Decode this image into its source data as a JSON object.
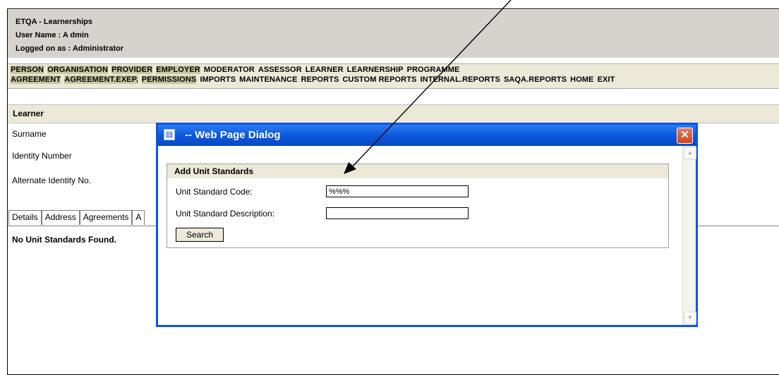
{
  "header": {
    "app_title": "ETQA - Learnerships",
    "user_name": "User Name : A dmin",
    "logged_on": "Logged on as : Administrator"
  },
  "menu": {
    "row1": [
      "PERSON",
      "ORGANISATION",
      "PROVIDER",
      "EMPLOYER",
      "MODERATOR",
      "ASSESSOR",
      "LEARNER",
      "LEARNERSHIP",
      "PROGRAMME"
    ],
    "row2": [
      "AGREEMENT",
      "AGREEMENT.EXEP.",
      "PERMISSIONS",
      "IMPORTS",
      "MAINTENANCE",
      "REPORTS",
      "CUSTOM REPORTS",
      "INTERNAL.REPORTS",
      "SAQA.REPORTS",
      "HOME",
      "EXIT"
    ]
  },
  "learner": {
    "section_title": "Learner",
    "surname_label": "Surname",
    "identity_label": "Identity Number",
    "alt_identity_label": "Alternate Identity No."
  },
  "tabs": [
    "Details",
    "Address",
    "Agreements",
    "A"
  ],
  "results": {
    "message": "No Unit Standards Found."
  },
  "dialog": {
    "title": "-- Web Page Dialog",
    "panel_title": "Add Unit Standards",
    "code_label": "Unit Standard Code:",
    "code_value": "%%%",
    "desc_label": "Unit Standard Description:",
    "desc_value": "",
    "search_label": "Search"
  },
  "icons": {
    "dialog_icon": "document-icon",
    "close_icon": "close-icon"
  },
  "colors": {
    "titlebar": "#0a56d8",
    "close_button": "#d1401c",
    "header_bg": "#d6d3ce",
    "menu_highlight": "#c7c7a0"
  }
}
